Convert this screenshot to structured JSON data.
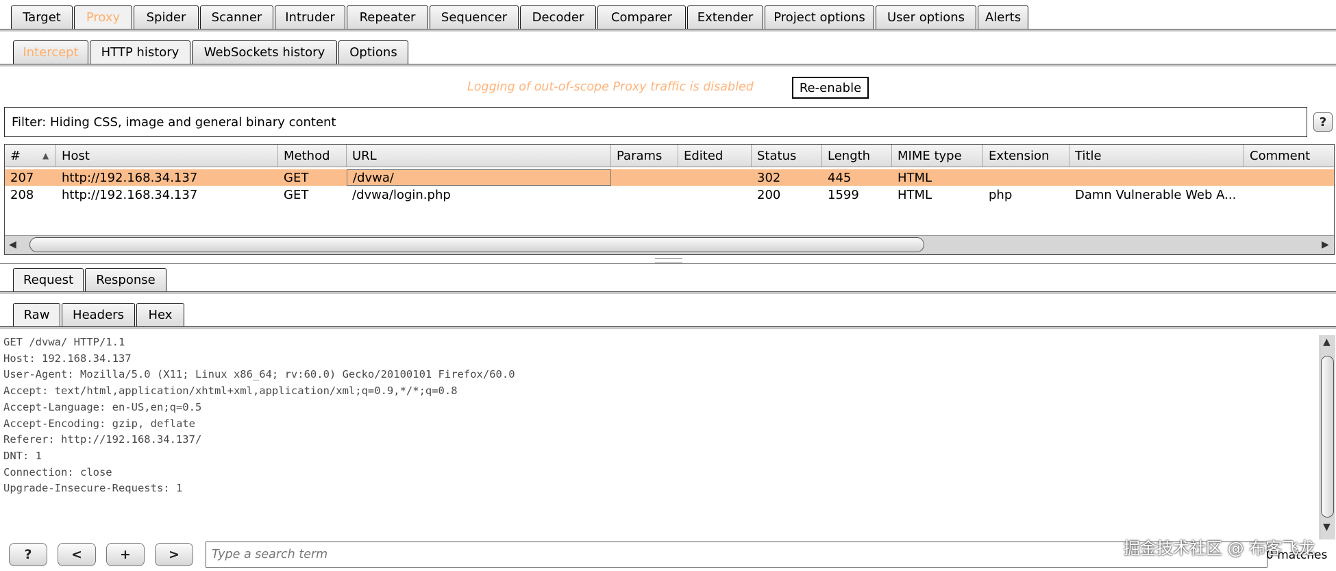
{
  "main_tabs": [
    {
      "label": "Target",
      "state": "normal"
    },
    {
      "label": "Proxy",
      "state": "active-orange"
    },
    {
      "label": "Spider",
      "state": "normal"
    },
    {
      "label": "Scanner",
      "state": "normal"
    },
    {
      "label": "Intruder",
      "state": "normal"
    },
    {
      "label": "Repeater",
      "state": "normal"
    },
    {
      "label": "Sequencer",
      "state": "normal"
    },
    {
      "label": "Decoder",
      "state": "normal"
    },
    {
      "label": "Comparer",
      "state": "normal"
    },
    {
      "label": "Extender",
      "state": "normal"
    },
    {
      "label": "Project options",
      "state": "normal"
    },
    {
      "label": "User options",
      "state": "normal"
    },
    {
      "label": "Alerts",
      "state": "normal"
    }
  ],
  "proxy_tabs": [
    {
      "label": "Intercept",
      "state": "orange"
    },
    {
      "label": "HTTP history",
      "state": "active"
    },
    {
      "label": "WebSockets history",
      "state": "normal"
    },
    {
      "label": "Options",
      "state": "normal"
    }
  ],
  "logging": {
    "message": "Logging of out-of-scope Proxy traffic is disabled",
    "button": "Re-enable"
  },
  "filter": {
    "text": "Filter: Hiding CSS, image and general binary content",
    "help": "?"
  },
  "table": {
    "columns": [
      "#",
      "Host",
      "Method",
      "URL",
      "Params",
      "Edited",
      "Status",
      "Length",
      "MIME type",
      "Extension",
      "Title",
      "Comment"
    ],
    "rows": [
      {
        "num": "207",
        "host": "http://192.168.34.137",
        "method": "GET",
        "url": "/dvwa/",
        "params": "",
        "edited": "",
        "status": "302",
        "length": "445",
        "mime": "HTML",
        "ext": "",
        "title": "",
        "comment": "",
        "selected": true
      },
      {
        "num": "208",
        "host": "http://192.168.34.137",
        "method": "GET",
        "url": "/dvwa/login.php",
        "params": "",
        "edited": "",
        "status": "200",
        "length": "1599",
        "mime": "HTML",
        "ext": "php",
        "title": "Damn Vulnerable Web A...",
        "comment": "",
        "selected": false
      }
    ]
  },
  "reqres_tabs": [
    {
      "label": "Request",
      "state": "active"
    },
    {
      "label": "Response",
      "state": "normal"
    }
  ],
  "view_tabs": [
    {
      "label": "Raw",
      "state": "active"
    },
    {
      "label": "Headers",
      "state": "normal"
    },
    {
      "label": "Hex",
      "state": "normal"
    }
  ],
  "request_lines": [
    "GET /dvwa/ HTTP/1.1",
    "Host: 192.168.34.137",
    "User-Agent: Mozilla/5.0 (X11; Linux x86_64; rv:60.0) Gecko/20100101 Firefox/60.0",
    "Accept: text/html,application/xhtml+xml,application/xml;q=0.9,*/*;q=0.8",
    "Accept-Language: en-US,en;q=0.5",
    "Accept-Encoding: gzip, deflate",
    "Referer: http://192.168.34.137/",
    "DNT: 1",
    "Connection: close",
    "Upgrade-Insecure-Requests: 1"
  ],
  "bottom": {
    "help": "?",
    "prev": "<",
    "add": "+",
    "next": ">",
    "search_placeholder": "Type a search term",
    "matches": "0 matches"
  },
  "watermark": "掘金技术社区 @ 布客飞龙"
}
